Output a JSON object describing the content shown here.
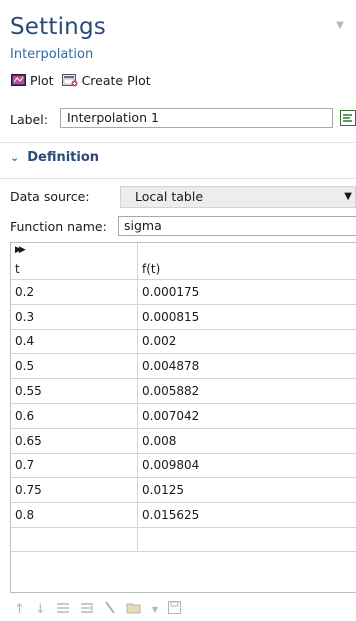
{
  "header": {
    "title": "Settings",
    "subtitle": "Interpolation"
  },
  "toolbar": {
    "plot_label": "Plot",
    "create_plot_label": "Create Plot"
  },
  "label_field": {
    "label": "Label:",
    "value": "Interpolation 1"
  },
  "definition": {
    "section_title": "Definition",
    "data_source": {
      "label": "Data source:",
      "value": "Local table"
    },
    "function_name": {
      "label": "Function name:",
      "value": "sigma"
    }
  },
  "table": {
    "columns": [
      "t",
      "f(t)"
    ],
    "rows": [
      [
        "0.2",
        "0.000175"
      ],
      [
        "0.3",
        "0.000815"
      ],
      [
        "0.4",
        "0.002"
      ],
      [
        "0.5",
        "0.004878"
      ],
      [
        "0.55",
        "0.005882"
      ],
      [
        "0.6",
        "0.007042"
      ],
      [
        "0.65",
        "0.008"
      ],
      [
        "0.7",
        "0.009804"
      ],
      [
        "0.75",
        "0.0125"
      ],
      [
        "0.8",
        "0.015625"
      ]
    ]
  },
  "bottom_toolbar": {
    "icons": [
      "move-up-icon",
      "move-down-icon",
      "insert-row-icon",
      "delete-row-icon",
      "clear-table-icon",
      "load-from-file-icon",
      "dropdown-arrow-icon",
      "save-icon"
    ]
  }
}
